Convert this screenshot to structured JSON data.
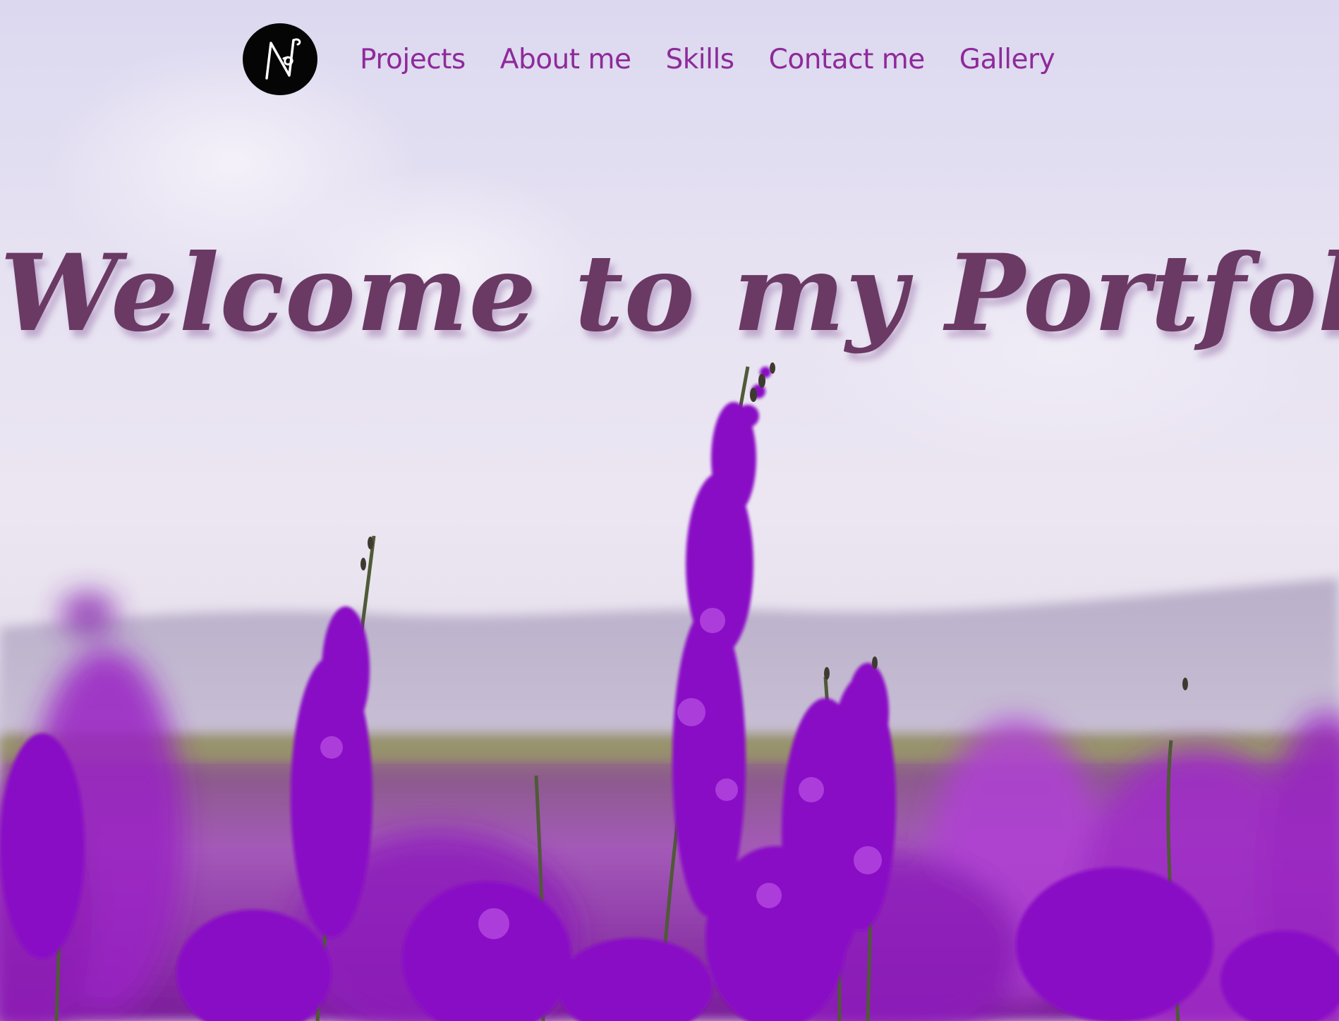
{
  "nav": {
    "logo_icon": "monogram-logo-icon",
    "items": [
      {
        "label": "Projects"
      },
      {
        "label": "About me"
      },
      {
        "label": "Skills"
      },
      {
        "label": "Contact me"
      },
      {
        "label": "Gallery"
      }
    ]
  },
  "hero": {
    "headline": "Welcome to my Portfolio",
    "background": "purple-flower-field-photo"
  },
  "colors": {
    "nav_link": "#8e2a9a",
    "headline": "#6a3a64",
    "flowers": "#9b1fc4",
    "sky": "#e2def0"
  }
}
